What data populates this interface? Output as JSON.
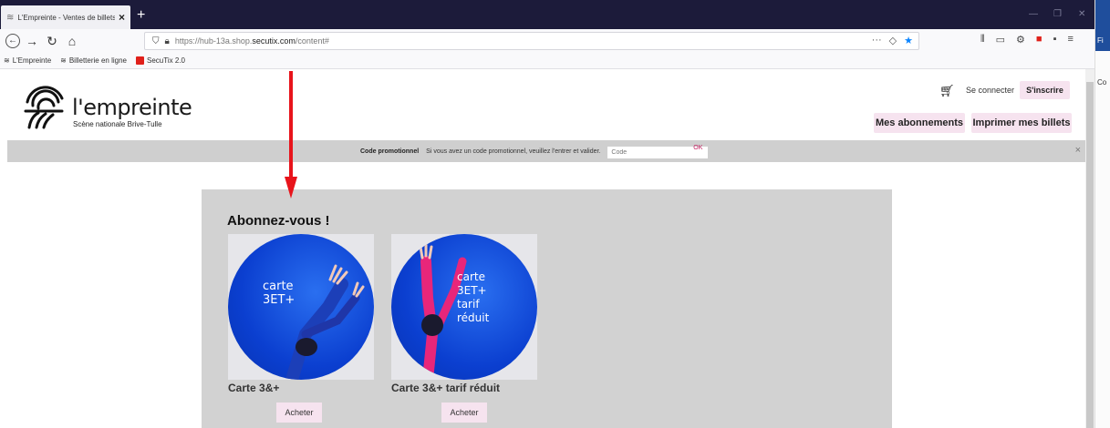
{
  "browser": {
    "tab_title": "L'Empreinte - Ventes de billets",
    "tab_close": "×",
    "new_tab": "+",
    "url_prefix": "https://hub-13a.shop.",
    "url_domain": "secutix.com",
    "url_path": "/content#",
    "url_actions": "···",
    "bookmarks": [
      {
        "label": "L'Empreinte"
      },
      {
        "label": "Billetterie en ligne"
      },
      {
        "label": "SecuTix 2.0"
      }
    ],
    "side_labels": [
      "Fi",
      "Co"
    ]
  },
  "header": {
    "brand": "l'empreinte",
    "tagline": "Scène nationale Brive-Tulle",
    "login_label": "Se connecter",
    "signup_label": "S'inscrire",
    "subscriptions_label": "Mes abonnements",
    "print_label": "Imprimer mes billets"
  },
  "promo": {
    "title": "Code promotionnel",
    "text": "Si vous avez un code promotionnel, veuillez l'entrer et valider.",
    "placeholder": "Code",
    "ok_label": "OK",
    "close": "×"
  },
  "panel": {
    "title": "Abonnez-vous !",
    "cards": [
      {
        "name": "Carte 3&+",
        "image_text": [
          "carte",
          "3ET+"
        ],
        "buy_label": "Acheter"
      },
      {
        "name": "Carte 3&+ tarif réduit",
        "image_text": [
          "carte",
          "3ET+",
          "tarif",
          "réduit"
        ],
        "buy_label": "Acheter"
      }
    ]
  },
  "colors": {
    "accent_pink": "#f6e3ef",
    "annotation_red": "#e8141b",
    "disc_blue": "#0b3fd0"
  }
}
